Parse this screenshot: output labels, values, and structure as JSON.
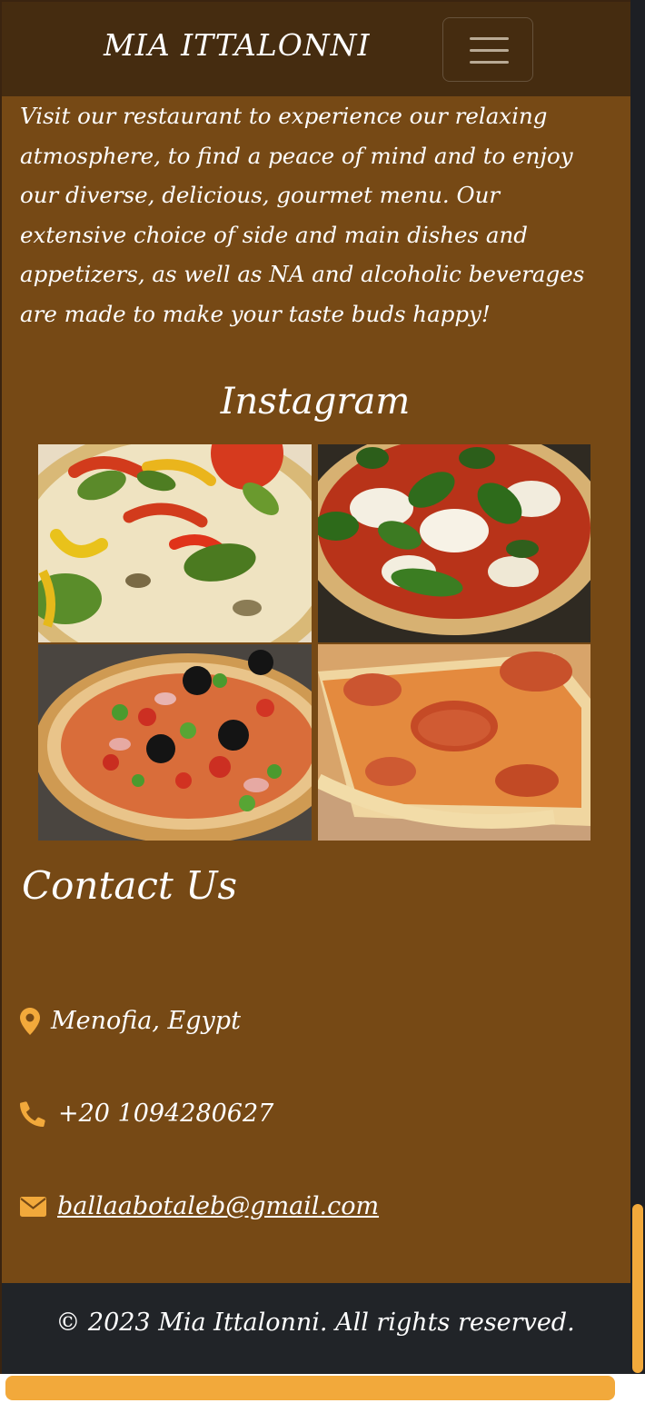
{
  "nav": {
    "brand": "MIA ITTALONNI",
    "toggler_icon": "hamburger-menu-icon"
  },
  "intro": {
    "text": "Visit our restaurant to experience our relaxing atmosphere, to find a peace of mind and to enjoy our diverse, delicious, gourmet menu. Our extensive choice of side and main dishes and appetizers, as well as NA and alcoholic beverages are made to make your taste buds happy!"
  },
  "instagram": {
    "title": "Instagram",
    "photos": [
      {
        "subject": "pepper-basil-pizza"
      },
      {
        "subject": "margherita-pizza"
      },
      {
        "subject": "olive-tomato-pizza"
      },
      {
        "subject": "pepperoni-pizza"
      }
    ]
  },
  "contact": {
    "title": "Contact Us",
    "location": {
      "icon": "map-marker-icon",
      "text": "Menofia, Egypt"
    },
    "phone": {
      "icon": "phone-icon",
      "text": "+20 1094280627"
    },
    "email": {
      "icon": "envelope-icon",
      "text": "ballaabotaleb@gmail.com"
    }
  },
  "footer": {
    "text": "© 2023 Mia Ittalonni. All rights reserved."
  },
  "colors": {
    "page_bg": "#764915",
    "navbar_bg": "#452c10",
    "footer_bg": "#212428",
    "accent": "#f2a93b",
    "text": "#ffffff"
  }
}
